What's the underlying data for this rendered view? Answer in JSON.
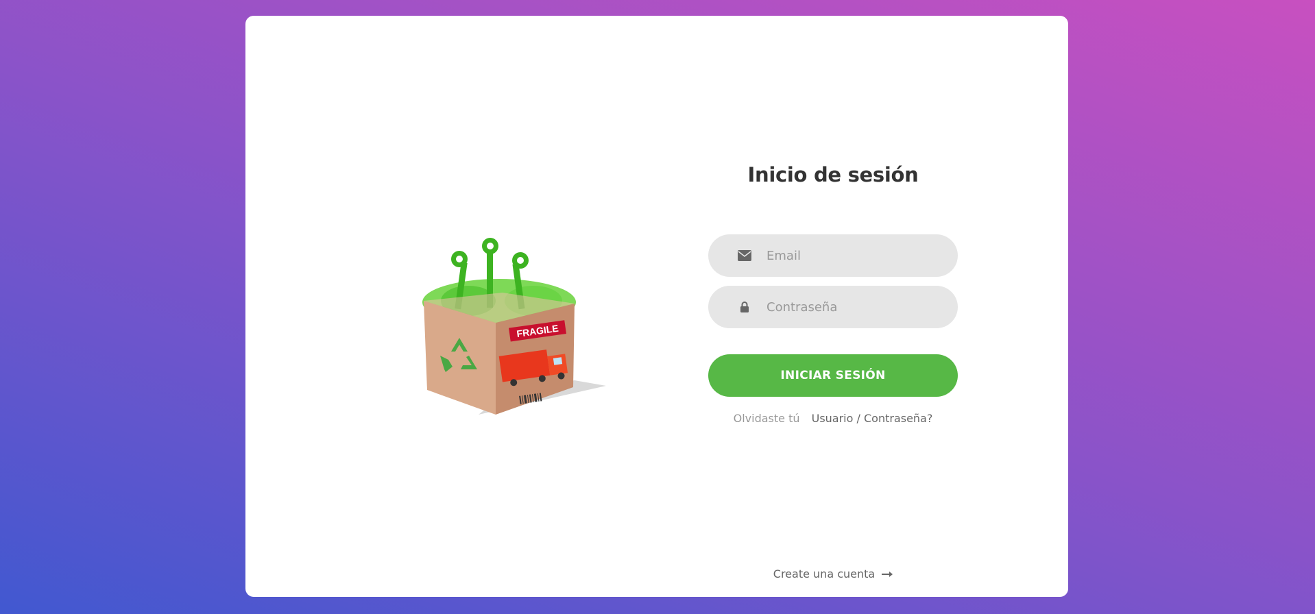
{
  "login": {
    "title": "Inicio de sesión",
    "email_placeholder": "Email",
    "password_placeholder": "Contraseña",
    "submit_label": "INICIAR SESIÓN",
    "forgot_prefix": "Olvidaste tú",
    "forgot_link": "Usuario / Contraseña?",
    "create_account": "Create una cuenta"
  },
  "illustration": {
    "box_label": "FRAGILE"
  },
  "colors": {
    "background_start": "#4158d0",
    "background_end": "#c850c0",
    "button": "#57b846",
    "input_bg": "#e6e6e6"
  },
  "icons": {
    "email": "envelope-icon",
    "password": "lock-icon",
    "create": "arrow-right-icon"
  }
}
